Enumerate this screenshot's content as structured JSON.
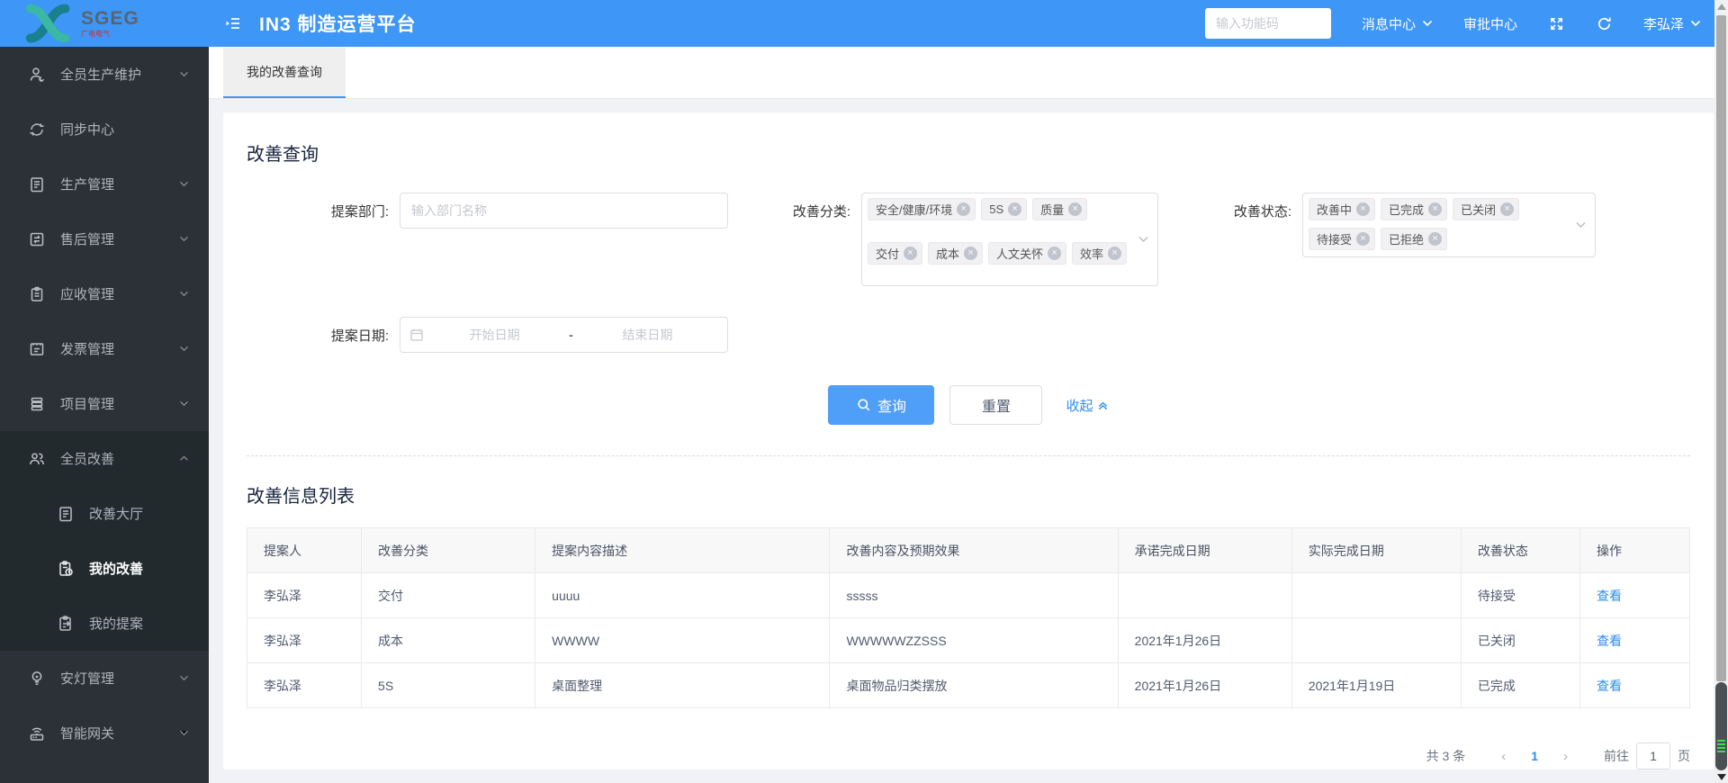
{
  "header": {
    "app_title": "IN3 制造运营平台",
    "brand_name": "SGEG",
    "brand_subtitle": "广电电气",
    "function_code_placeholder": "输入功能码",
    "message_center": "消息中心",
    "approval_center": "审批中心",
    "username": "李弘泽"
  },
  "sidebar": {
    "items": [
      {
        "label": "全员生产维护"
      },
      {
        "label": "同步中心"
      },
      {
        "label": "生产管理"
      },
      {
        "label": "售后管理"
      },
      {
        "label": "应收管理"
      },
      {
        "label": "发票管理"
      },
      {
        "label": "项目管理"
      },
      {
        "label": "全员改善"
      },
      {
        "label": "改善大厅"
      },
      {
        "label": "我的改善"
      },
      {
        "label": "我的提案"
      },
      {
        "label": "安灯管理"
      },
      {
        "label": "智能网关"
      }
    ]
  },
  "tab": {
    "label": "我的改善查询"
  },
  "query": {
    "title": "改善查询",
    "dept_label": "提案部门:",
    "dept_placeholder": "输入部门名称",
    "category_label": "改善分类:",
    "category_tags": [
      "安全/健康/环境",
      "5S",
      "质量",
      "交付",
      "成本",
      "人文关怀",
      "效率"
    ],
    "status_label": "改善状态:",
    "status_tags": [
      "改善中",
      "已完成",
      "已关闭",
      "待接受",
      "已拒绝"
    ],
    "date_label": "提案日期:",
    "date_start_placeholder": "开始日期",
    "date_separator": "-",
    "date_end_placeholder": "结束日期",
    "search_button": "查询",
    "reset_button": "重置",
    "collapse_link": "收起"
  },
  "list": {
    "title": "改善信息列表",
    "columns": [
      "提案人",
      "改善分类",
      "提案内容描述",
      "改善内容及预期效果",
      "承诺完成日期",
      "实际完成日期",
      "改善状态",
      "操作"
    ],
    "view_label": "查看",
    "rows": [
      {
        "proposer": "李弘泽",
        "category": "交付",
        "desc": "uuuu",
        "effect": "sssss",
        "promised": "",
        "actual": "",
        "status": "待接受"
      },
      {
        "proposer": "李弘泽",
        "category": "成本",
        "desc": "WWWW",
        "effect": "WWWWWZZSSS",
        "promised": "2021年1月26日",
        "actual": "",
        "status": "已关闭"
      },
      {
        "proposer": "李弘泽",
        "category": "5S",
        "desc": "桌面整理",
        "effect": "桌面物品归类摆放",
        "promised": "2021年1月26日",
        "actual": "2021年1月19日",
        "status": "已完成"
      }
    ]
  },
  "pagination": {
    "total": "共 3 条",
    "prev": "‹",
    "next": "›",
    "current_page": "1",
    "goto_label": "前往",
    "goto_value": "1",
    "page_unit": "页"
  },
  "icons": {
    "close": "×"
  },
  "colors": {
    "header_blue": "#3e96f6",
    "primary_button": "#4f9ef7",
    "link_blue": "#2d8cf0",
    "sidebar_bg": "#2b3137",
    "sidebar_group_bg": "#232a2e",
    "logo_teal": "#38b8a5",
    "logo_dark_teal": "#1a7f8e"
  }
}
